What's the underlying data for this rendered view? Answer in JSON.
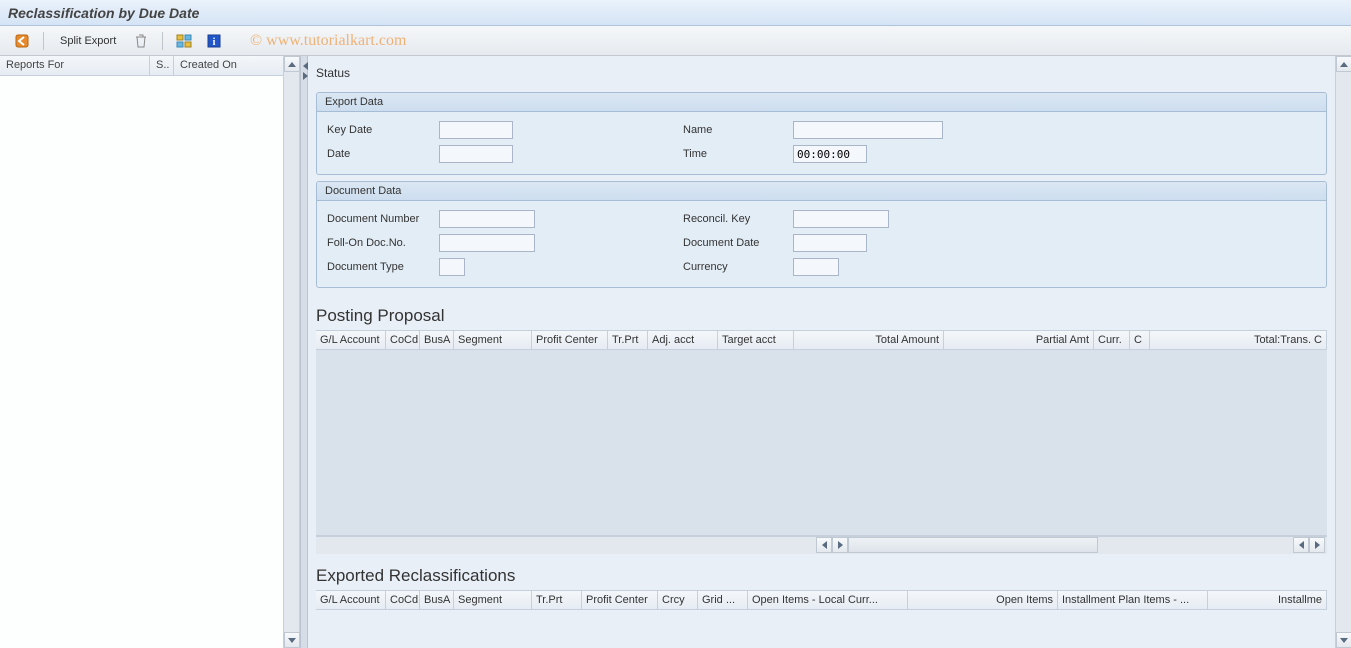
{
  "window": {
    "title": "Reclassification by Due Date"
  },
  "toolbar": {
    "back_label": "Back",
    "split_export_label": "Split Export",
    "delete_label": "Delete",
    "layout_label": "Change Layout",
    "info_label": "Information"
  },
  "watermark": "© www.tutorialkart.com",
  "left": {
    "col_reports_for": "Reports For",
    "col_col2": "S..",
    "col_created_on": "Created On"
  },
  "right": {
    "status_label": "Status",
    "export_legend": "Export Data",
    "key_date_label": "Key Date",
    "key_date_value": "",
    "name_label": "Name",
    "name_value": "",
    "date_label": "Date",
    "date_value": "",
    "time_label": "Time",
    "time_value": "00:00:00",
    "doc_legend": "Document Data",
    "doc_number_label": "Document Number",
    "doc_number_value": "",
    "reconcil_key_label": "Reconcil. Key",
    "reconcil_key_value": "",
    "follon_label": "Foll-On Doc.No.",
    "follon_value": "",
    "doc_date_label": "Document Date",
    "doc_date_value": "",
    "doc_type_label": "Document Type",
    "doc_type_value": "",
    "currency_label": "Currency",
    "currency_value": ""
  },
  "proposal": {
    "title": "Posting Proposal",
    "cols": {
      "c0": "G/L Account",
      "c1": "CoCd",
      "c2": "BusA",
      "c3": "Segment",
      "c4": "Profit Center",
      "c5": "Tr.Prt",
      "c6": "Adj. acct",
      "c7": "Target acct",
      "c8": "Total Amount",
      "c9": "Partial Amt",
      "c10": "Curr.",
      "c11": "C",
      "c12": "Total:Trans. C"
    }
  },
  "exported": {
    "title": "Exported Reclassifications",
    "cols": {
      "c0": "G/L Account",
      "c1": "CoCd",
      "c2": "BusA",
      "c3": "Segment",
      "c4": "Tr.Prt",
      "c5": "Profit Center",
      "c6": "Crcy",
      "c7": "Grid ...",
      "c8": "Open Items - Local Curr...",
      "c9": "Open Items",
      "c10": "Installment Plan Items - ...",
      "c11": "Installme"
    }
  }
}
